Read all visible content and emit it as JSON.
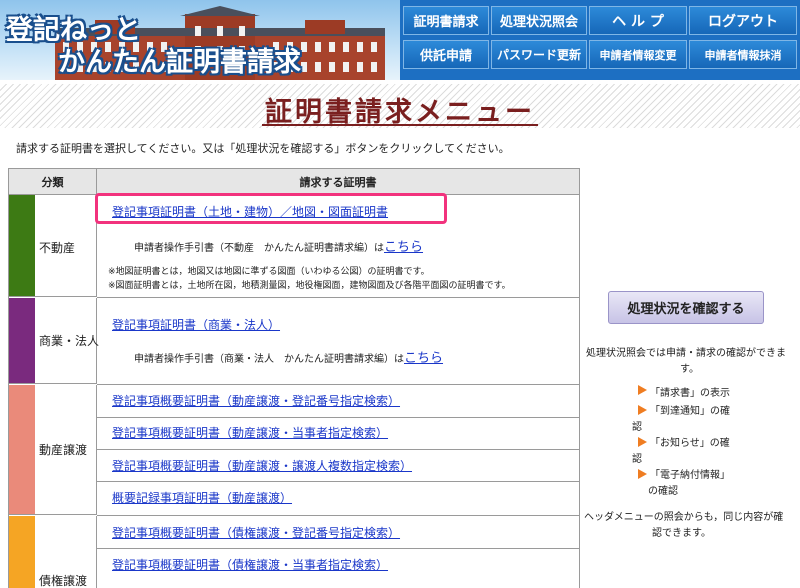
{
  "header": {
    "logo_line1": "登記ねっと",
    "logo_line2": "かんたん証明書請求",
    "nav": [
      {
        "label": "証明書請求"
      },
      {
        "label": "処理状況照会"
      },
      {
        "label": "ヘ ル プ"
      },
      {
        "label": "ログアウト"
      },
      {
        "label": "供託申請"
      },
      {
        "label": "パスワード更新"
      },
      {
        "label": "申請者情報変更"
      },
      {
        "label": "申請者情報抹消"
      }
    ]
  },
  "page": {
    "title": "証明書請求メニュー",
    "intro": "請求する証明書を選択してください。又は「処理状況を確認する」ボタンをクリックしてください。"
  },
  "table": {
    "header_category": "分類",
    "header_certificate": "請求する証明書",
    "categories": [
      {
        "label": "不動産",
        "color": "#3d7a14",
        "links": [
          "登記事項証明書（土地・建物）／地図・図面証明書"
        ],
        "guide_text": "申請者操作手引書（不動産　かんたん証明書請求編）は",
        "guide_link": "こちら",
        "notes": [
          "※地図証明書とは，地図又は地図に準ずる図面（いわゆる公図）の証明書です。",
          "※図面証明書とは，土地所在図，地積測量図，地役権図面，建物図面及び各階平面図の証明書です。"
        ]
      },
      {
        "label": "商業・法人",
        "color": "#7a2a7e",
        "links": [
          "登記事項証明書（商業・法人）"
        ],
        "guide_text": "申請者操作手引書（商業・法人　かんたん証明書請求編）は",
        "guide_link": "こちら"
      },
      {
        "label": "動産譲渡",
        "color": "#ea8a7a",
        "links": [
          "登記事項概要証明書（動産譲渡・登記番号指定検索）",
          "登記事項概要証明書（動産譲渡・当事者指定検索）",
          "登記事項概要証明書（動産譲渡・譲渡人複数指定検索）",
          "概要記録事項証明書（動産譲渡）"
        ]
      },
      {
        "label": "債権譲渡",
        "color": "#f5a524",
        "links": [
          "登記事項概要証明書（債権譲渡・登記番号指定検索）",
          "登記事項概要証明書（債権譲渡・当事者指定検索）"
        ]
      }
    ]
  },
  "panel": {
    "status_button": "処理状況を確認する",
    "desc_line1": "処理状況照会では申請・請求の確認ができま",
    "desc_line2": "す。",
    "items": [
      {
        "line1": "「請求書」の表示",
        "line2": ""
      },
      {
        "line1": "「到達通知」の確",
        "line2": "認"
      },
      {
        "line1": "「お知らせ」の確",
        "line2": "認"
      },
      {
        "line1": "「電子納付情報」",
        "line2": "の確認"
      }
    ],
    "footer_line1": "ヘッダメニューの照会からも，同じ内容が確",
    "footer_line2": "認できます。"
  }
}
